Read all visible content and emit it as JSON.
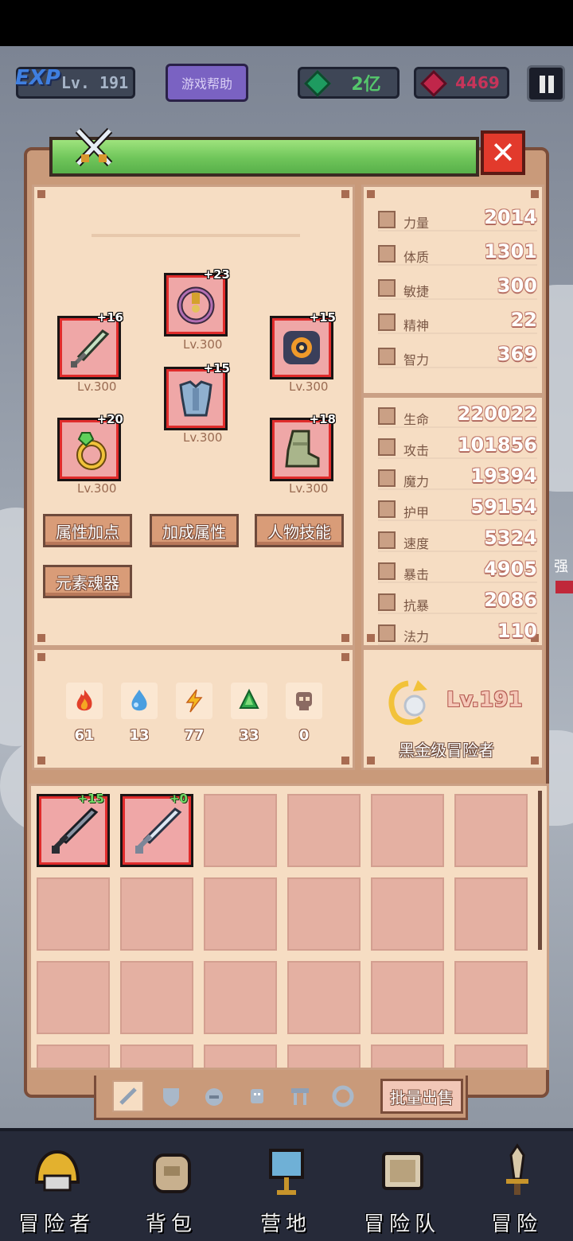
{
  "top_bar": {
    "exp_tag": "EXP",
    "exp_level": "Lv. 191",
    "help_button": "游戏帮助",
    "gems": "2亿",
    "rubies": "4469"
  },
  "equipment": {
    "slots": [
      {
        "plus": "+23",
        "level": "Lv.300",
        "icon": "amulet-icon"
      },
      {
        "plus": "+16",
        "level": "Lv.300",
        "icon": "sword-icon"
      },
      {
        "plus": "+15",
        "level": "Lv.300",
        "icon": "eye-orb-icon"
      },
      {
        "plus": "+15",
        "level": "Lv.300",
        "icon": "chest-armor-icon"
      },
      {
        "plus": "+20",
        "level": "Lv.300",
        "icon": "ring-icon"
      },
      {
        "plus": "+18",
        "level": "Lv.300",
        "icon": "boots-icon"
      }
    ],
    "buttons": [
      "属性加点",
      "加成属性",
      "人物技能",
      "元素魂器"
    ]
  },
  "elements": [
    {
      "value": "61",
      "icon": "fire-icon"
    },
    {
      "value": "13",
      "icon": "water-icon"
    },
    {
      "value": "77",
      "icon": "lightning-icon"
    },
    {
      "value": "33",
      "icon": "earth-icon"
    },
    {
      "value": "0",
      "icon": "skull-icon"
    }
  ],
  "base_attributes": [
    {
      "name": "力量",
      "value": "2014"
    },
    {
      "name": "体质",
      "value": "1301"
    },
    {
      "name": "敏捷",
      "value": "300"
    },
    {
      "name": "精神",
      "value": "22"
    },
    {
      "name": "智力",
      "value": "369"
    }
  ],
  "combat_attributes": [
    {
      "name": "生命",
      "value": "220022"
    },
    {
      "name": "攻击",
      "value": "101856"
    },
    {
      "name": "魔力",
      "value": "19394"
    },
    {
      "name": "护甲",
      "value": "59154"
    },
    {
      "name": "速度",
      "value": "5324"
    },
    {
      "name": "暴击",
      "value": "4905"
    },
    {
      "name": "抗暴",
      "value": "2086"
    },
    {
      "name": "法力",
      "value": "110"
    }
  ],
  "rank": {
    "level": "Lv.191",
    "title": "黑金级冒险者"
  },
  "inventory": {
    "items": [
      {
        "plus": "+15",
        "icon": "dark-sword-icon"
      },
      {
        "plus": "+0",
        "icon": "steel-sword-icon"
      }
    ],
    "sell_button": "批量出售"
  },
  "side": {
    "text": "强"
  },
  "nav": [
    {
      "label": "冒险者",
      "icon": "helmet-icon"
    },
    {
      "label": "背包",
      "icon": "backpack-icon"
    },
    {
      "label": "营地",
      "icon": "banner-icon"
    },
    {
      "label": "冒险队",
      "icon": "book-icon"
    },
    {
      "label": "冒险",
      "icon": "dagger-icon"
    }
  ],
  "colors": {
    "accent_green": "#6fc55a",
    "panel": "#f6ddc3",
    "frame": "#7a4d3a",
    "slot_red": "#e02c2c"
  }
}
